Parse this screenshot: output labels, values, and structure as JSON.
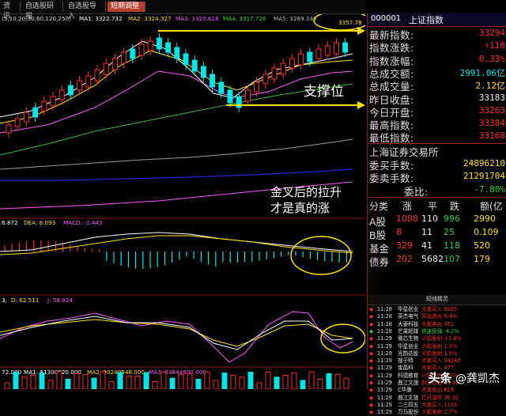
{
  "tabs": [
    {
      "label": "资讯",
      "active": false
    },
    {
      "label": "自选股研报",
      "active": false
    },
    {
      "label": "自选股导入",
      "active": false
    },
    {
      "label": "短期调整",
      "active": true
    }
  ],
  "legend_ma": {
    "prefix": "(5,10,20,30,60,120,250)",
    "ma1": "MA1: 3322.732",
    "ma2": "MA2: 3324.327",
    "ma3": "MA3: 3320.618",
    "ma4": "MA4: 3317.726",
    "ma5": "MA5: 3289.146"
  },
  "price_label": "3357.78",
  "annotations": {
    "support": "支撑位",
    "golden1": "金叉后的拉升",
    "golden2": "才是真的涨"
  },
  "legend_macd": {
    "diff": "6.872",
    "dea": "DEA: 8.093",
    "macd": "MACD: -2.443"
  },
  "legend_kdj": {
    "k": "3,",
    "d": "D: 62.511",
    "j": "J: 58.924"
  },
  "legend_vol": {
    "vol": "72.000",
    "ma1": "MA1: 81300920.000",
    "ma2": "MA2: 90240548.000",
    "ma3": "MA3: 83644800.000"
  },
  "quote": {
    "code": "000001",
    "name": "上证指数",
    "rows": [
      {
        "label": "最新指数:",
        "value": "33294",
        "color": "red"
      },
      {
        "label": "指数涨跌:",
        "value": "↑110",
        "color": "red"
      },
      {
        "label": "指数涨幅:",
        "value": "0.33%",
        "color": "red"
      },
      {
        "label": "总成交额:",
        "value": "2991.06亿",
        "color": "cyan"
      },
      {
        "label": "总成交量:",
        "value": "2.12亿",
        "color": "yel"
      },
      {
        "label": "昨日收盘:",
        "value": "33183",
        "color": "white"
      },
      {
        "label": "今日开盘:",
        "value": "33263",
        "color": "red"
      },
      {
        "label": "最高指数:",
        "value": "33384",
        "color": "red"
      },
      {
        "label": "最低指数:",
        "value": "33168",
        "color": "red"
      }
    ],
    "exchange": "上海证券交易所",
    "rows2": [
      {
        "label": "委买手数:",
        "value": "24896210",
        "color": "yel"
      },
      {
        "label": "委卖手数:",
        "value": "21291704",
        "color": "yel"
      },
      {
        "label": "委比:",
        "value": "-7.80%",
        "color": "grn"
      }
    ],
    "market_head": [
      "分类",
      "涨",
      "平",
      "跌",
      "额(亿"
    ],
    "market_rows": [
      {
        "c": "A股",
        "up": "1088",
        "flat": "110",
        "down": "996",
        "amt": "2990"
      },
      {
        "c": "B股",
        "up": "8",
        "flat": "11",
        "down": "25",
        "amt": "0.109"
      },
      {
        "c": "基金",
        "up": "329",
        "flat": "41",
        "down": "118",
        "amt": "520"
      },
      {
        "c": "债券",
        "up": "202",
        "flat": "5682",
        "down": "107",
        "amt": "179"
      }
    ]
  },
  "ticks_header": "短线精灵",
  "ticks": [
    {
      "m": "◆",
      "mc": "red",
      "t": "11:28",
      "n": "华星创业",
      "a": "大笔买入 8085",
      "ac": "red"
    },
    {
      "m": "◆",
      "mc": "red",
      "t": "11:28",
      "n": "英杰电气",
      "a": "高台跳水 6.4%",
      "ac": "red"
    },
    {
      "m": "◆",
      "mc": "red",
      "t": "11:28",
      "n": "大豪科技",
      "a": "大笔卖出 451",
      "ac": "red"
    },
    {
      "m": "◆",
      "mc": "grn",
      "t": "11:28",
      "n": "芒果超媒",
      "a": "快速反弹 -4.2%",
      "ac": "grn"
    },
    {
      "m": "◆",
      "mc": "red",
      "t": "11:29",
      "n": "微芯生物",
      "a": "火箭发射 +1.8%",
      "ac": "red"
    },
    {
      "m": "◆",
      "mc": "red",
      "t": "11:29",
      "n": "华星创业",
      "a": "火箭发射 1.3%",
      "ac": "red"
    },
    {
      "m": "◆",
      "mc": "red",
      "t": "11:29",
      "n": "光韵达股",
      "a": "火箭发射 1.9%",
      "ac": "red"
    },
    {
      "m": "◆",
      "mc": "red",
      "t": "11:29",
      "n": "搜于特",
      "a": "大笔买入 34240",
      "ac": "red"
    },
    {
      "m": "◆",
      "mc": "red",
      "t": "11:29",
      "n": "金晶科",
      "a": "大笔买入 477",
      "ac": "red"
    },
    {
      "m": "◆",
      "mc": "red",
      "t": "11:29",
      "n": "科德教育",
      "a": "火箭发射 5.5%",
      "ac": "red"
    },
    {
      "m": "◆",
      "mc": "red",
      "t": "11:29",
      "n": "曲江文旅",
      "a": "封涨停板 20.93",
      "ac": "red"
    },
    {
      "m": "◆",
      "mc": "red",
      "t": "11:29",
      "n": "C华康",
      "a": "大笔卖出 616",
      "ac": "red"
    },
    {
      "m": "◆",
      "mc": "red",
      "t": "11:29",
      "n": "曲江文旅",
      "a": "打开涨停 20.92",
      "ac": "red"
    },
    {
      "m": "◆",
      "mc": "red",
      "t": "11:29",
      "n": "二三四五",
      "a": "大笔买入 1193",
      "ac": "red"
    },
    {
      "m": "◆",
      "mc": "red",
      "t": "11:29",
      "n": "万马股份",
      "a": "火箭发射 2.7%",
      "ac": "red"
    }
  ],
  "watermark": {
    "brand": "头条",
    "handle": "@龚凯杰"
  }
}
